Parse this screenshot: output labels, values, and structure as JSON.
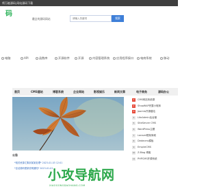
{
  "topbar": {
    "text": "将万能源码,网站源码下载"
  },
  "header": {
    "logo_text": "码",
    "tagline": "最全的源码网站",
    "search_placeholder": "请输入关键词",
    "search_button": "搜索"
  },
  "categories": [
    {
      "label": "电脑",
      "icon": "monitor-icon"
    },
    {
      "label": "API",
      "icon": "api-icon"
    },
    {
      "label": "函数库",
      "icon": "function-icon"
    },
    {
      "label": "开源软件",
      "icon": "open-source-icon"
    },
    {
      "label": "开源",
      "icon": "code-icon"
    },
    {
      "label": "内容管理系统",
      "icon": "cms-icon"
    },
    {
      "label": "应用程序接口",
      "icon": "interface-icon"
    },
    {
      "label": "电商系统",
      "icon": "shop-icon"
    },
    {
      "label": "移动",
      "icon": "mobile-icon"
    }
  ],
  "main_nav": [
    "首页",
    "CMS建站",
    "博客系统",
    "企业网站",
    "影视娱乐",
    "新闻文章",
    "电子商务",
    "源码办公"
  ],
  "notice": {
    "title": "公告",
    "items": [
      "*相关资源汇集到某某处理*  2023-01-03 12:01",
      "*全站源码更新说明通知*  2023-01-01"
    ]
  },
  "sidebar": {
    "items": [
      {
        "num": "1",
        "text": "CMS网站系统源"
      },
      {
        "num": "2",
        "text": "ShopWAP完整小程序"
      },
      {
        "num": "3",
        "text": "Joomla开源建站"
      },
      {
        "num": "4",
        "text": "LiteAdmin后台管"
      },
      {
        "num": "5",
        "text": "SiteServer CMS"
      },
      {
        "num": "6",
        "text": "WordPress主题"
      },
      {
        "num": "7",
        "text": "Laravel框架商城"
      },
      {
        "num": "8",
        "text": "Dedecms模板"
      },
      {
        "num": "9",
        "text": "EmpireCMS"
      },
      {
        "num": "10",
        "text": "Z-Blog 博客"
      },
      {
        "num": "11",
        "text": "PHPCMS开源系统"
      }
    ]
  },
  "watermark": {
    "text": "小攻导航网",
    "sub": "XIAOGONGDAOHANG.COM"
  },
  "colors": {
    "accent": "#3e7fd8",
    "brand_green": "#2fb35c",
    "watermark_green": "#2ba84a",
    "topbar": "#3f3f3f"
  }
}
